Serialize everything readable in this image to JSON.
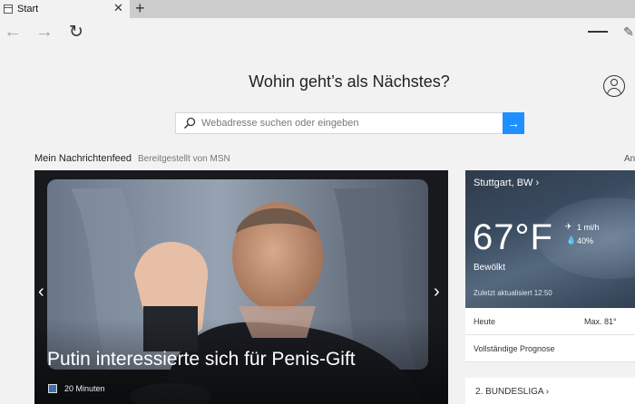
{
  "tab": {
    "title": "Start",
    "close": "✕",
    "new_tab": "+"
  },
  "toolbar": {
    "back_icon": "←",
    "forward_icon": "→",
    "reload_icon": "↻",
    "note_icon": "✎"
  },
  "start": {
    "headline": "Wohin geht’s als Nächstes?",
    "search_placeholder": "Webadresse suchen oder eingeben",
    "go_icon": "→"
  },
  "feed": {
    "title": "Mein Nachrichtenfeed",
    "source": "Bereitgestellt von MSN",
    "more": "An"
  },
  "hero": {
    "title": "Putin interessierte sich für Penis-Gift",
    "time": "20 Minuten",
    "prev_icon": "‹",
    "next_icon": "›"
  },
  "weather": {
    "city": "Stuttgart, BW ›",
    "temperature": "67°F",
    "wind_icon": "✈",
    "wind": "1 mi/h",
    "humidity_icon": "💧",
    "humidity": "40%",
    "condition": "Bewölkt",
    "updated": "Zuletzt aktualisiert 12:50",
    "today_label": "Heute",
    "today_value": "Max. 81°",
    "forecast_label": "Vollständige Prognose"
  },
  "bundesliga": {
    "label": "2. BUNDESLIGA ›"
  },
  "colors": {
    "accent": "#1e90ff",
    "background": "#f2f2f2",
    "tabstrip": "#cccccc"
  }
}
